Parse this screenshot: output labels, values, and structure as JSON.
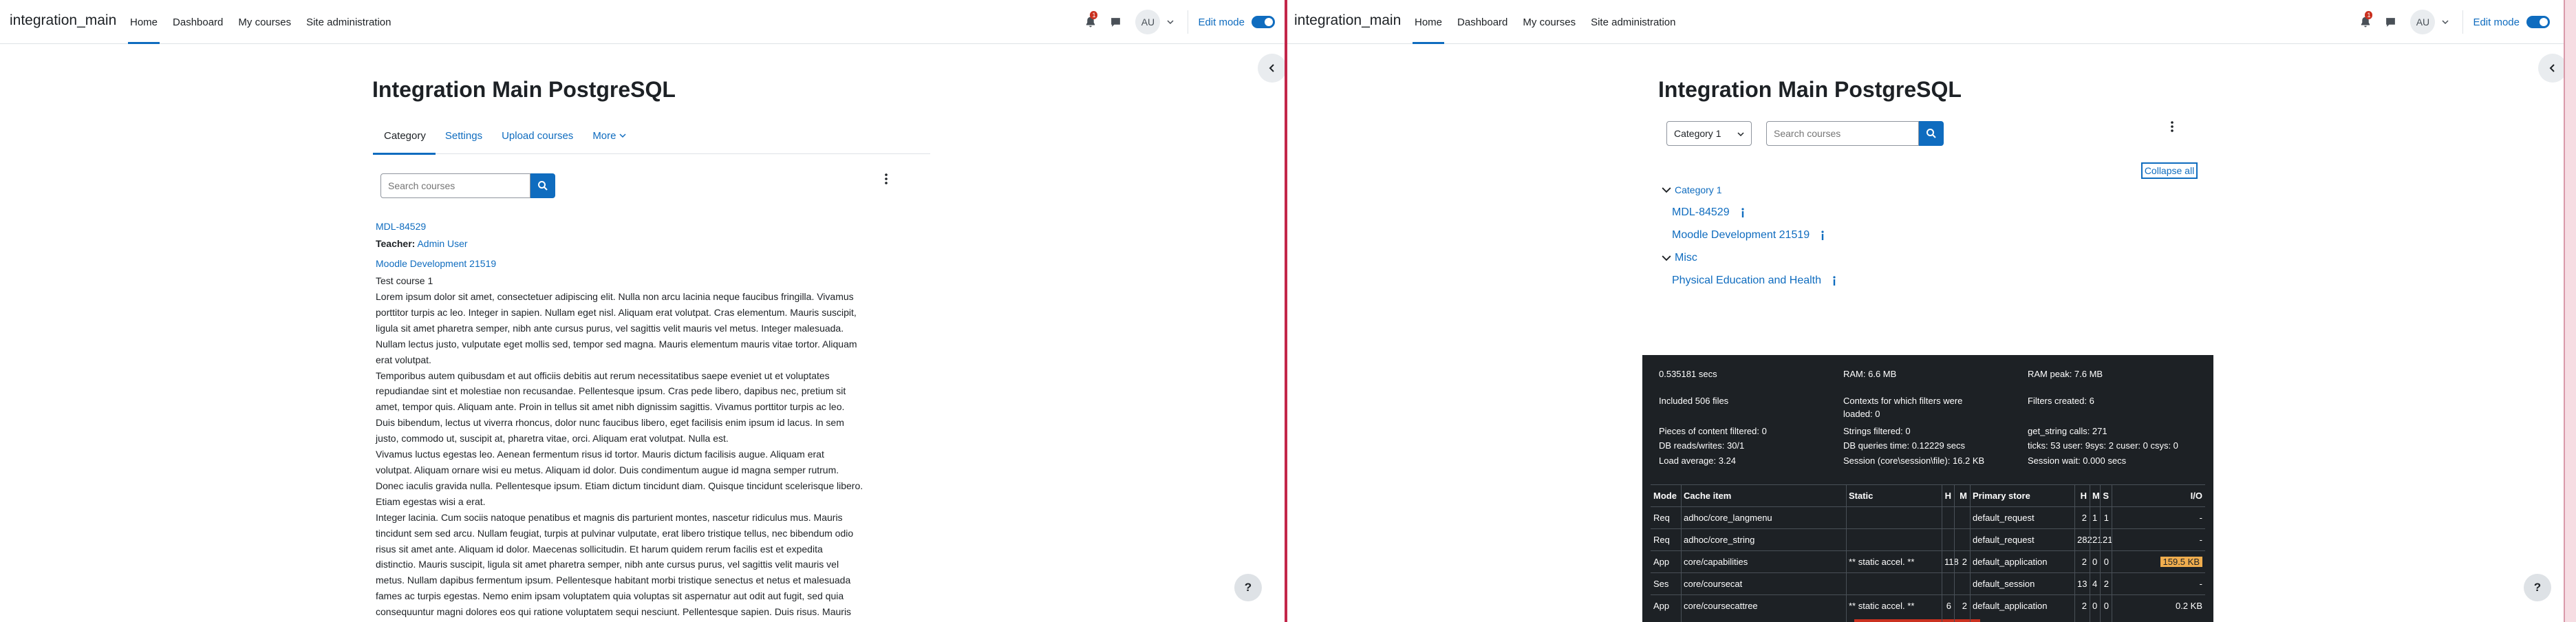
{
  "left": {
    "navbar": {
      "brand": "integration_main",
      "items": [
        "Home",
        "Dashboard",
        "My courses",
        "Site administration"
      ],
      "notification_count": "1",
      "avatar_initials": "AU",
      "edit_mode_label": "Edit mode"
    },
    "page_title": "Integration Main PostgreSQL",
    "tabs": [
      "Category",
      "Settings",
      "Upload courses",
      "More"
    ],
    "search_placeholder": "Search courses",
    "courses": [
      {
        "name": "MDL-84529",
        "teacher_label": "Teacher:",
        "teacher_name": "Admin User"
      },
      {
        "name": "Moodle Development 21519",
        "summary_title": "Test course 1"
      }
    ],
    "lorem_lines": [
      "Lorem ipsum dolor sit amet, consectetuer adipiscing elit. Nulla non arcu lacinia neque faucibus fringilla. Vivamus",
      "porttitor turpis ac leo. Integer in sapien. Nullam eget nisl. Aliquam erat volutpat. Cras elementum. Mauris suscipit,",
      "ligula sit amet pharetra semper, nibh ante cursus purus, vel sagittis velit mauris vel metus. Integer malesuada.",
      "Nullam lectus justo, vulputate eget mollis sed, tempor sed magna. Mauris elementum mauris vitae tortor. Aliquam",
      "erat volutpat.",
      "Temporibus autem quibusdam et aut officiis debitis aut rerum necessitatibus saepe eveniet ut et voluptates",
      "repudiandae sint et molestiae non recusandae. Pellentesque ipsum. Cras pede libero, dapibus nec, pretium sit",
      "amet, tempor quis. Aliquam ante. Proin in tellus sit amet nibh dignissim sagittis. Vivamus porttitor turpis ac leo.",
      "Duis bibendum, lectus ut viverra rhoncus, dolor nunc faucibus libero, eget facilisis enim ipsum id lacus. In sem",
      "justo, commodo ut, suscipit at, pharetra vitae, orci. Aliquam erat volutpat. Nulla est.",
      "Vivamus luctus egestas leo. Aenean fermentum risus id tortor. Mauris dictum facilisis augue. Aliquam erat",
      "volutpat. Aliquam ornare wisi eu metus. Aliquam id dolor. Duis condimentum augue id magna semper rutrum.",
      "Donec iaculis gravida nulla. Pellentesque ipsum. Etiam dictum tincidunt diam. Quisque tincidunt scelerisque libero.",
      "Etiam egestas wisi a erat.",
      "Integer lacinia. Cum sociis natoque penatibus et magnis dis parturient montes, nascetur ridiculus mus. Mauris",
      "tincidunt sem sed arcu. Nullam feugiat, turpis at pulvinar vulputate, erat libero tristique tellus, nec bibendum odio",
      "risus sit amet ante. Aliquam id dolor. Maecenas sollicitudin. Et harum quidem rerum facilis est et expedita",
      "distinctio. Mauris suscipit, ligula sit amet pharetra semper, nibh ante cursus purus, vel sagittis velit mauris vel",
      "metus. Nullam dapibus fermentum ipsum. Pellentesque habitant morbi tristique senectus et netus et malesuada",
      "fames ac turpis egestas. Nemo enim ipsam voluptatem quia voluptas sit aspernatur aut odit aut fugit, sed quia",
      "consequuntur magni dolores eos qui ratione voluptatem sequi nesciunt. Pellentesque sapien. Duis risus. Mauris"
    ],
    "help_label": "?"
  },
  "right": {
    "navbar": {
      "brand": "integration_main",
      "items": [
        "Home",
        "Dashboard",
        "My courses",
        "Site administration"
      ],
      "notification_count": "1",
      "avatar_initials": "AU",
      "edit_mode_label": "Edit mode"
    },
    "page_title": "Integration Main PostgreSQL",
    "category_select": "Category 1",
    "search_placeholder": "Search courses",
    "collapse_all": "Collapse all",
    "tree": {
      "cat1": "Category 1",
      "course1": "MDL-84529",
      "course2": "Moodle Development 21519",
      "cat2": "Misc",
      "course3": "Physical Education and Health"
    },
    "perf": {
      "time": "0.535181 secs",
      "ram": "RAM: 6.6 MB",
      "ram_peak": "RAM peak: 7.6 MB",
      "included": "Included 506 files",
      "contexts_1": "Contexts for which filters were",
      "contexts_2": "loaded: 0",
      "filters_created": "Filters created: 6",
      "pieces": "Pieces of content filtered: 0",
      "strings": "Strings filtered: 0",
      "get_string": "get_string calls: 271",
      "db_rw": "DB reads/writes: 30/1",
      "db_time": "DB queries time: 0.12229 secs",
      "ticks": "ticks: 53 user: 9sys: 2 cuser: 0 csys: 0",
      "load": "Load average: 3.24",
      "session": "Session (core\\session\\file): 16.2 KB",
      "session_wait": "Session wait: 0.000 secs",
      "headers": [
        "Mode",
        "Cache item",
        "Static",
        "H",
        "M",
        "Primary store",
        "H",
        "M",
        "S",
        "I/O"
      ],
      "rows": [
        [
          "Req",
          "adhoc/core_langmenu",
          "",
          "",
          "",
          "default_request",
          "2",
          "1",
          "1",
          "-"
        ],
        [
          "Req",
          "adhoc/core_string",
          "",
          "",
          "",
          "default_request",
          "282",
          "21",
          "21",
          "-"
        ],
        [
          "App",
          "core/capabilities",
          "** static accel. **",
          "118",
          "2",
          "default_application",
          "2",
          "0",
          "0",
          "159.5 KB"
        ],
        [
          "Ses",
          "core/coursecat",
          "",
          "",
          "",
          "default_session",
          "13",
          "4",
          "2",
          "-"
        ],
        [
          "App",
          "core/coursecattree",
          "** static accel. **",
          "6",
          "2",
          "default_application",
          "2",
          "0",
          "0",
          "0.2 KB"
        ]
      ]
    },
    "help_label": "?"
  },
  "colors": {
    "accent": "#0f6cbf",
    "divider": "#c3264a",
    "footer_bg": "#1d2125",
    "highlight": "#f0ad4e"
  }
}
